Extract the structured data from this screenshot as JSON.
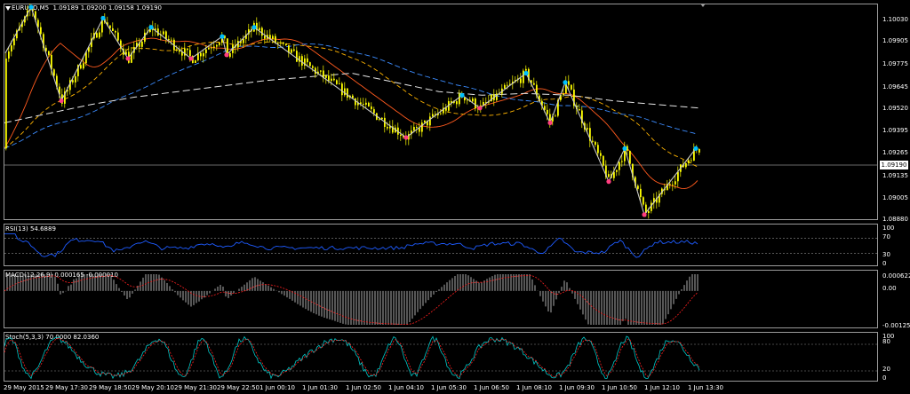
{
  "header": {
    "menu_icon": "triangle-down-icon",
    "symbol_text": "EURUSD,M5",
    "ohlc_text": "1.09189 1.09200 1.09158 1.09190"
  },
  "indicators": {
    "rsi_label": "RSI(13) 54.6889",
    "macd_label": "MACD(12,26,9) 0.000165 -0.000010",
    "stoch_label": "Stoch(5,3,3) 70.0000 82.0360"
  },
  "price_axis": {
    "ticks": [
      "1.10030",
      "1.09905",
      "1.09775",
      "1.09645",
      "1.09520",
      "1.09395",
      "1.09265",
      "1.09135",
      "1.09005",
      "1.08880"
    ],
    "current_price": "1.09190"
  },
  "rsi_axis": {
    "ticks": [
      "100",
      "70",
      "30",
      "0"
    ]
  },
  "macd_axis": {
    "ticks": [
      "0.000622",
      "0.00",
      "-0.001258"
    ]
  },
  "stoch_axis": {
    "ticks": [
      "100",
      "80",
      "20",
      "0"
    ]
  },
  "time_axis": {
    "labels": [
      "29 May 2015",
      "29 May 17:30",
      "29 May 18:50",
      "29 May 20:10",
      "29 May 21:30",
      "29 May 22:50",
      "1 Jun 00:10",
      "1 Jun 01:30",
      "1 Jun 02:50",
      "1 Jun 04:10",
      "1 Jun 05:30",
      "1 Jun 06:50",
      "1 Jun 08:10",
      "1 Jun 09:30",
      "1 Jun 10:50",
      "1 Jun 12:10",
      "1 Jun 13:30"
    ]
  },
  "colors": {
    "candles": "#ffff00",
    "zigzag": "#c8c8c8",
    "swing_high_marker": "#00bfff",
    "swing_low_marker": "#ff3d7f",
    "rsi_line": "#1e5bff",
    "macd_histogram": "#d8d8d8",
    "macd_signal": "#ff2020",
    "stoch_main": "#00c8c8",
    "stoch_signal": "#ff2020",
    "ma_fast": "#ff5a1e",
    "ma_mid": "#ffb400",
    "ma_slow": "#3c8cff",
    "ma_long": "#e6e6e6"
  },
  "chart_data": {
    "type": "line",
    "title": "EURUSD,M5",
    "ylim": [
      1.0888,
      1.1003
    ],
    "x": [
      "29 May 2015",
      "29 May 17:30",
      "29 May 18:50",
      "29 May 20:10",
      "29 May 21:30",
      "29 May 22:50",
      "1 Jun 00:10",
      "1 Jun 01:30",
      "1 Jun 02:50",
      "1 Jun 04:10",
      "1 Jun 05:30",
      "1 Jun 06:50",
      "1 Jun 08:10",
      "1 Jun 09:30",
      "1 Jun 10:50",
      "1 Jun 12:10",
      "1 Jun 13:30"
    ],
    "series": [
      {
        "values": [
          1.097,
          1.1002,
          1.0955,
          1.0995,
          1.098,
          1.099,
          1.0978,
          1.0984,
          1.0988,
          1.097,
          1.0935,
          1.0935,
          1.0957,
          1.0962,
          1.0955,
          1.0945,
          1.092
        ]
      },
      {
        "values": [
          1.094,
          1.0945,
          1.095,
          1.0954,
          1.0957,
          1.096,
          1.0963,
          1.0965,
          1.0967,
          1.0962,
          1.0957,
          1.0955,
          1.0956,
          1.0955,
          1.0952,
          1.095,
          1.0948
        ]
      }
    ],
    "zigzag": [
      {
        "x": 1,
        "y": 1.0978
      },
      {
        "x": 30,
        "y": 1.1003
      },
      {
        "x": 64,
        "y": 1.0952
      },
      {
        "x": 111,
        "y": 1.0997
      },
      {
        "x": 139,
        "y": 1.0975
      },
      {
        "x": 165,
        "y": 1.0992
      },
      {
        "x": 210,
        "y": 1.0975
      },
      {
        "x": 245,
        "y": 1.0987
      },
      {
        "x": 250,
        "y": 1.0977
      },
      {
        "x": 281,
        "y": 1.0992
      },
      {
        "x": 452,
        "y": 1.0932
      },
      {
        "x": 515,
        "y": 1.0955
      },
      {
        "x": 535,
        "y": 1.0948
      },
      {
        "x": 587,
        "y": 1.0967
      },
      {
        "x": 614,
        "y": 1.094
      },
      {
        "x": 631,
        "y": 1.0962
      },
      {
        "x": 680,
        "y": 1.0908
      },
      {
        "x": 698,
        "y": 1.0926
      },
      {
        "x": 720,
        "y": 1.089
      },
      {
        "x": 778,
        "y": 1.0926
      }
    ],
    "rsi": {
      "ylim": [
        0,
        100
      ],
      "levels": [
        70,
        30
      ]
    },
    "macd": {
      "ylim": [
        -0.001258,
        0.000622
      ]
    },
    "stoch": {
      "ylim": [
        0,
        100
      ],
      "levels": [
        80,
        20
      ]
    }
  }
}
